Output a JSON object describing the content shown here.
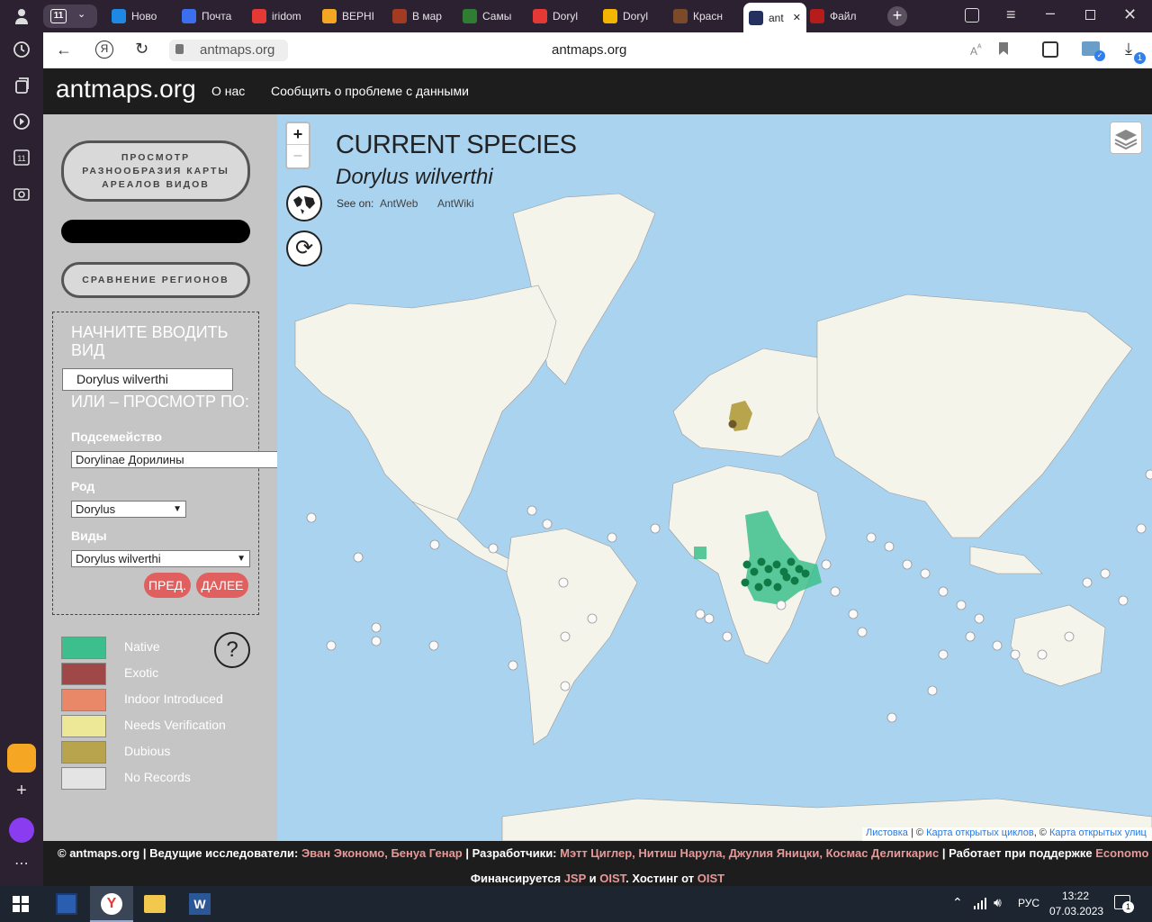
{
  "browser": {
    "tab_count": "11",
    "tabs": [
      {
        "label": "Ново",
        "icon": "mail-at-icon",
        "color": "#1e88e5"
      },
      {
        "label": "Почта",
        "icon": "mail-envelope-icon",
        "color": "#3b6ff0"
      },
      {
        "label": "iridom",
        "icon": "yandex-icon",
        "color": "#e53935"
      },
      {
        "label": "ВЕРНІ",
        "icon": "globe-icon",
        "color": "#f5a623"
      },
      {
        "label": "В мар",
        "icon": "b-icon",
        "color": "#a23b22"
      },
      {
        "label": "Самы",
        "icon": "leaf-icon",
        "color": "#2e7d32"
      },
      {
        "label": "Doryl",
        "icon": "yandex-icon",
        "color": "#e53935"
      },
      {
        "label": "Doryl",
        "icon": "mountain-icon",
        "color": "#f2b600"
      },
      {
        "label": "Красн",
        "icon": "ant-icon",
        "color": "#7b4a2a"
      },
      {
        "label": "ant",
        "icon": "antmaps-icon",
        "color": "#24305e"
      },
      {
        "label": "Файл",
        "icon": "devil-icon",
        "color": "#b71c1c"
      }
    ],
    "url": "antmaps.org",
    "page_title": "antmaps.org",
    "download_badge": "1"
  },
  "site": {
    "logo": "antmaps.org",
    "nav": [
      "О нас",
      "Сообщить о проблеме с данными"
    ]
  },
  "panel": {
    "btn_diversity": "ПРОСМОТР РАЗНООБРАЗИЯ КАРТЫ АРЕАЛОВ ВИДОВ",
    "btn_compare": "СРАВНЕНИЕ РЕГИОНОВ",
    "search_heading": "НАЧНИТЕ ВВОДИТЬ ВИД",
    "search_value": "Dorylus wilverthi",
    "browse_heading": "ИЛИ – ПРОСМОТР ПО:",
    "subfamily_label": "Подсемейство",
    "subfamily_value": "Dorylinae Дорилины",
    "genus_label": "Род",
    "genus_value": "Dorylus",
    "species_label": "Виды",
    "species_value": "Dorylus wilverthi",
    "prev": "ПРЕД.",
    "next": "ДАЛЕЕ",
    "help": "?"
  },
  "legend": [
    {
      "label": "Native",
      "color": "#3cbf8c"
    },
    {
      "label": "Exotic",
      "color": "#a04848"
    },
    {
      "label": "Indoor Introduced",
      "color": "#e88868"
    },
    {
      "label": "Needs Verification",
      "color": "#ece898"
    },
    {
      "label": "Dubious",
      "color": "#b8a44c"
    },
    {
      "label": "No Records",
      "color": "#e4e4e4"
    }
  ],
  "map": {
    "zoom_in": "+",
    "zoom_out": "–",
    "title": "CURRENT SPECIES",
    "species": "Dorylus wilverthi",
    "see_on": "See on:",
    "links": [
      "AntWeb",
      "AntWiki"
    ],
    "attribution": {
      "a": "Листовка",
      "sep1": " | © ",
      "b": "Карта открытых циклов",
      "sep2": ", © ",
      "c": "Карта открытых улиц"
    }
  },
  "footer": {
    "line1_a": "© antmaps.org | Ведущие исследователи: ",
    "line1_b": "Эван Экономо, Бенуа Генар",
    "line1_c": " | Разработчики: ",
    "line1_d": "Мэтт Циглер, Нитиш Нарула, Джулия Яницки, Космас Делигкарис",
    "line1_e": " | Работает при поддержке ",
    "line1_f": "Economo Lab",
    "line1_g": " |",
    "line2_a": "Финансируется ",
    "line2_b": "JSP",
    "line2_c": " и ",
    "line2_d": "OIST",
    "line2_e": ". Хостинг от ",
    "line2_f": "OIST"
  },
  "taskbar": {
    "lang": "РУС",
    "time": "13:22",
    "date": "07.03.2023",
    "notif": "1"
  }
}
